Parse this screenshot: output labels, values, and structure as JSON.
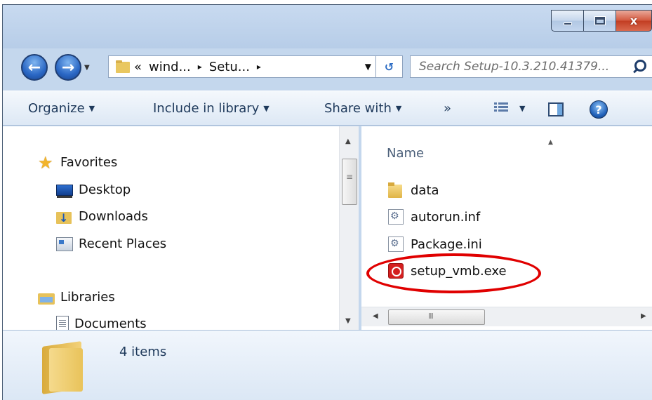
{
  "window": {
    "caption_buttons": {
      "minimize_icon": "minimize-icon",
      "maximize_icon": "maximize-icon",
      "close_label": "x"
    }
  },
  "nav": {
    "back_label": "←",
    "forward_label": "→",
    "address": {
      "prefix": "«",
      "segments": [
        "wind...",
        "Setu..."
      ],
      "separator": "▸"
    },
    "search": {
      "placeholder": "Search Setup-10.3.210.41379..."
    }
  },
  "commandbar": {
    "organize": "Organize",
    "include_in_library": "Include in library",
    "share_with": "Share with",
    "more": "»",
    "help": "?"
  },
  "navpane": {
    "items": [
      {
        "label": "Favorites",
        "icon": "star-icon"
      },
      {
        "label": "Desktop",
        "icon": "desktop-icon"
      },
      {
        "label": "Downloads",
        "icon": "downloads-folder-icon"
      },
      {
        "label": "Recent Places",
        "icon": "recent-places-icon"
      },
      {
        "label": "Libraries",
        "icon": "libraries-icon"
      },
      {
        "label": "Documents",
        "icon": "document-icon"
      }
    ]
  },
  "content": {
    "column_header": "Name",
    "files": [
      {
        "name": "data",
        "icon": "folder-icon"
      },
      {
        "name": "autorun.inf",
        "icon": "settings-file-icon"
      },
      {
        "name": "Package.ini",
        "icon": "settings-file-icon"
      },
      {
        "name": "setup_vmb.exe",
        "icon": "exe-app-icon"
      }
    ],
    "highlight_color": "#e00000"
  },
  "details": {
    "item_count": "4 items"
  }
}
